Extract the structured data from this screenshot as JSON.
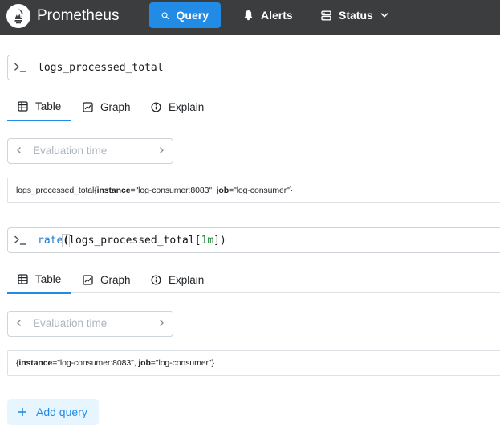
{
  "navbar": {
    "brand": "Prometheus",
    "query_label": "Query",
    "alerts_label": "Alerts",
    "status_label": "Status",
    "icons": [
      "prometheus-logo",
      "search-icon",
      "bell-icon",
      "server-icon",
      "chevron-down-icon"
    ]
  },
  "panels": [
    {
      "expression_plain": "logs_processed_total",
      "tabs": [
        "Table",
        "Graph",
        "Explain"
      ],
      "active_tab": "Table",
      "eval_placeholder": "Evaluation time",
      "result": {
        "metric": "logs_processed_total",
        "open": "{",
        "instance_key": "instance",
        "instance_value": "=\"log-consumer:8083\", ",
        "job_key": "job",
        "job_value": "=\"log-consumer\"",
        "close": "}"
      }
    },
    {
      "expression": {
        "fn": "rate",
        "open": "(",
        "metric": "logs_processed_total[",
        "range": "1m",
        "close": "])"
      },
      "tabs": [
        "Table",
        "Graph",
        "Explain"
      ],
      "active_tab": "Table",
      "eval_placeholder": "Evaluation time",
      "result": {
        "metric": "",
        "open": "{",
        "instance_key": "instance",
        "instance_value": "=\"log-consumer:8083\", ",
        "job_key": "job",
        "job_value": "=\"log-consumer\"",
        "close": "}"
      }
    }
  ],
  "add_query_label": "Add query",
  "colors": {
    "navbar_bg": "#3c3d3f",
    "accent": "#228be6",
    "add_query_bg": "#e7f5ff"
  }
}
